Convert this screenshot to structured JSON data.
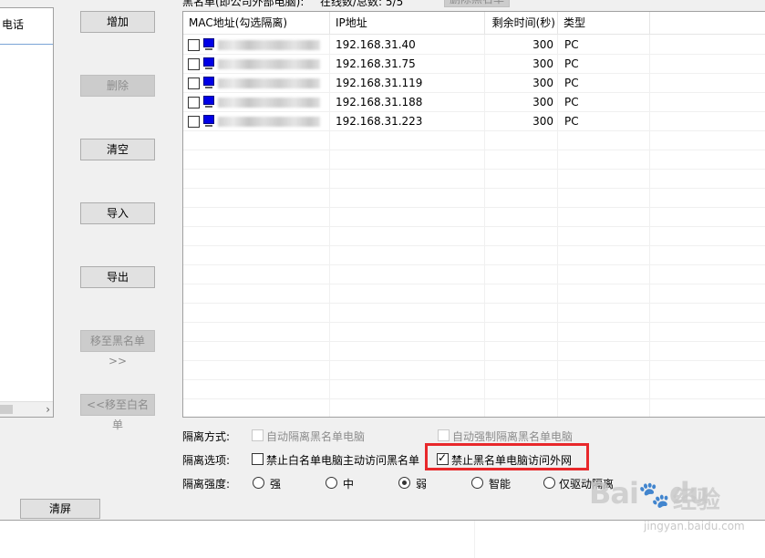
{
  "left_panel": {
    "column_header": "电话"
  },
  "buttons": {
    "add": "增加",
    "delete": "删除",
    "clear": "清空",
    "import": "导入",
    "export": "导出",
    "move_to_blacklist": "移至黑名单>>",
    "move_to_whitelist": "<<移至白名单",
    "clear_screen": "清屏"
  },
  "blacklist": {
    "label": "黑名单(即公司外部电脑):",
    "count": "在线数/总数: 5/5",
    "remove_button": "删除黑名单"
  },
  "table": {
    "columns": [
      "MAC地址(勾选隔离)",
      "IP地址",
      "剩余时间(秒)",
      "类型"
    ],
    "rows": [
      {
        "ip": "192.168.31.40",
        "time": "300",
        "type": "PC"
      },
      {
        "ip": "192.168.31.75",
        "time": "300",
        "type": "PC"
      },
      {
        "ip": "192.168.31.119",
        "time": "300",
        "type": "PC"
      },
      {
        "ip": "192.168.31.188",
        "time": "300",
        "type": "PC"
      },
      {
        "ip": "192.168.31.223",
        "time": "300",
        "type": "PC"
      }
    ]
  },
  "options": {
    "isolation_mode_label": "隔离方式:",
    "auto_isolate": "自动隔离黑名单电脑",
    "auto_force_isolate": "自动强制隔离黑名单电脑",
    "isolation_options_label": "隔离选项:",
    "block_whitelist_access": "禁止白名单电脑主动访问黑名单",
    "block_blacklist_internet": "禁止黑名单电脑访问外网",
    "strength_label": "隔离强度:",
    "strength_strong": "强",
    "strength_medium": "中",
    "strength_weak": "弱",
    "strength_smart": "智能",
    "strength_driver_only": "仅驱动隔离",
    "selected_strength": "弱"
  },
  "watermark": {
    "logo": "Bai",
    "logo_tail": "du",
    "cn": "经验",
    "url": "jingyan.baidu.com"
  },
  "colors": {
    "highlight": "#e8282b",
    "pc_icon": "#0000e6"
  }
}
